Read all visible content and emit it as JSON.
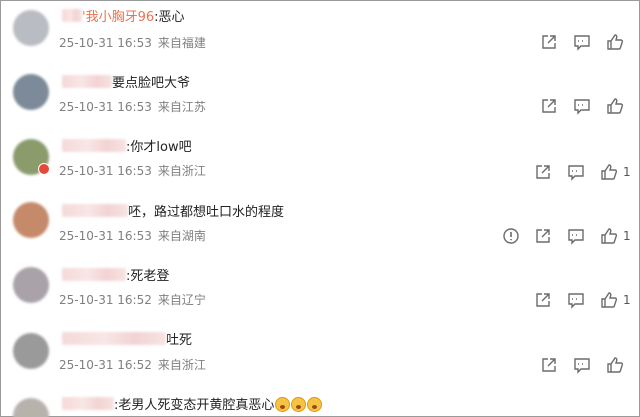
{
  "comments": [
    {
      "nick_visible": "'我小胸牙96",
      "text": ":恶心",
      "date": "25-10-31 16:53",
      "location": "来自福建",
      "likes": "",
      "avatar_color": "#b9bcc2"
    },
    {
      "nick_visible": "",
      "text": "要点脸吧大爷",
      "date": "25-10-31 16:53",
      "location": "来自江苏",
      "likes": "",
      "avatar_color": "#7d8a99"
    },
    {
      "nick_visible": "",
      "text": ":你才low吧",
      "date": "25-10-31 16:53",
      "location": "来自浙江",
      "likes": "1",
      "avatar_color": "#8a9b6c"
    },
    {
      "nick_visible": "",
      "text": "呸，路过都想吐口水的程度",
      "date": "25-10-31 16:53",
      "location": "来自湖南",
      "likes": "1",
      "avatar_color": "#c48a6a"
    },
    {
      "nick_visible": "",
      "text": ":死老登",
      "date": "25-10-31 16:52",
      "location": "来自辽宁",
      "likes": "1",
      "avatar_color": "#a9a2a8"
    },
    {
      "nick_visible": "",
      "text": "吐死",
      "date": "25-10-31 16:52",
      "location": "来自浙江",
      "likes": "",
      "avatar_color": "#9a9a9a"
    },
    {
      "nick_visible": "",
      "text": ":老男人死变态开黄腔真恶心",
      "date": "",
      "location": "",
      "likes": "",
      "avatar_color": "#b8b2ad"
    }
  ],
  "icons": {
    "share": "share-icon",
    "comment": "comment-icon",
    "like": "like-icon",
    "report": "report-icon",
    "emoji": "crying-emoji-icon"
  },
  "colors": {
    "nick": "#eb7350",
    "meta": "#808080",
    "icon": "#6b6b6b"
  }
}
